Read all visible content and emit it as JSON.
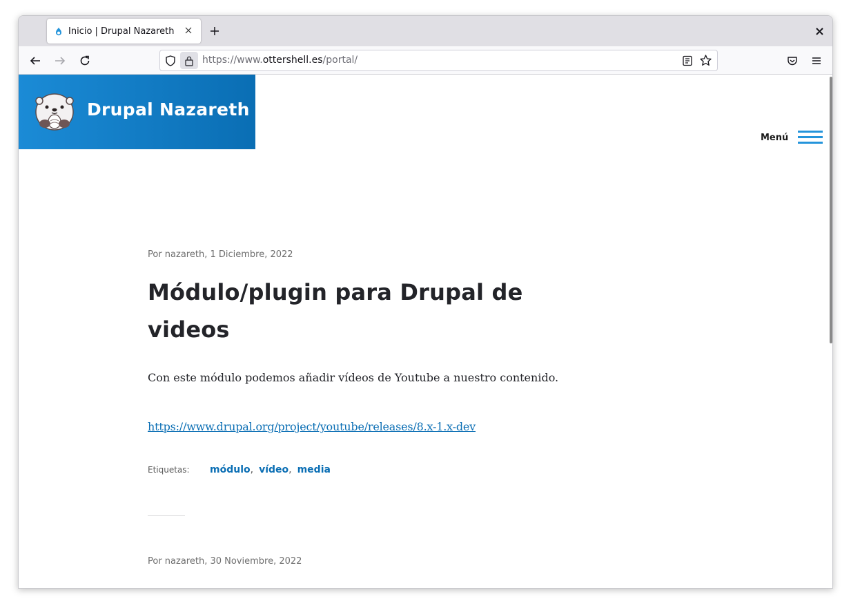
{
  "browser": {
    "tab_title": "Inicio | Drupal Nazareth",
    "url_prefix": "https://www.",
    "url_host": "ottershell.es",
    "url_path": "/portal/"
  },
  "site": {
    "name": "Drupal Nazareth",
    "menu_label": "Menú",
    "accent_color": "#0a6eb4"
  },
  "articles": [
    {
      "meta": "Por nazareth, 1 Diciembre, 2022",
      "title": "Módulo/plugin para Drupal de videos",
      "body": "Con este módulo podemos añadir vídeos de Youtube a nuestro contenido.",
      "link": "https://www.drupal.org/project/youtube/releases/8.x-1.x-dev",
      "tags_label": "Etiquetas:",
      "tags": [
        "módulo",
        "vídeo",
        "media"
      ]
    },
    {
      "meta": "Por nazareth, 30 Noviembre, 2022"
    }
  ]
}
